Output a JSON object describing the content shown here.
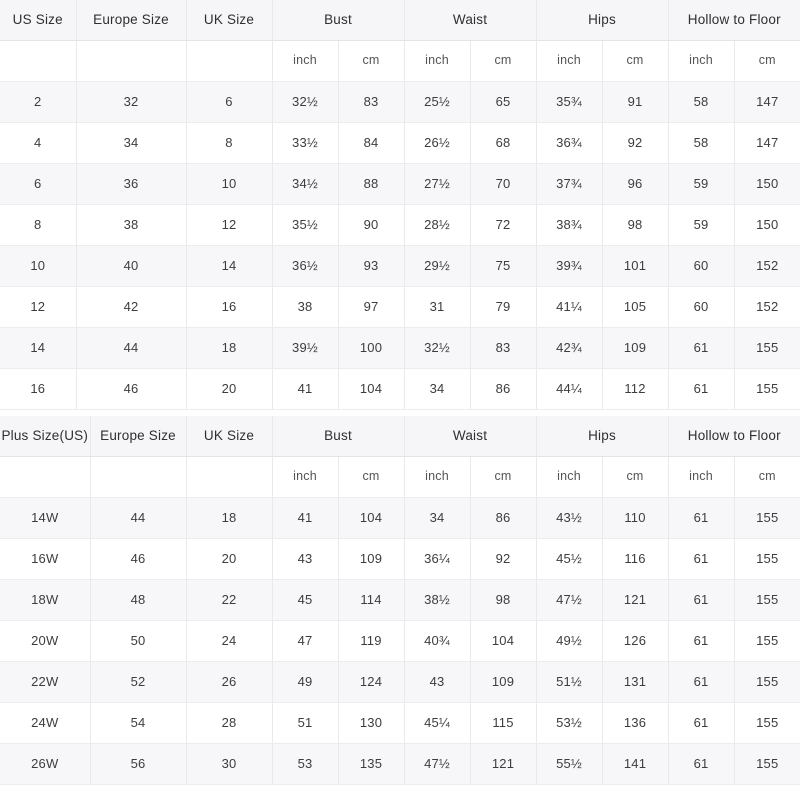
{
  "colors": {
    "header_bg": "#f6f6f8",
    "row_alt_bg": "#f7f7f9",
    "row_bg": "#ffffff",
    "border": "#e9e9ec",
    "text": "#3d3d3f"
  },
  "tables": [
    {
      "id": "standard-size-table",
      "headers": [
        "US Size",
        "Europe Size",
        "UK Size",
        "Bust",
        "Waist",
        "Hips",
        "Hollow to Floor"
      ],
      "units": [
        "",
        "",
        "",
        "inch",
        "cm",
        "inch",
        "cm",
        "inch",
        "cm",
        "inch",
        "cm"
      ],
      "rows": [
        [
          "2",
          "32",
          "6",
          "32½",
          "83",
          "25½",
          "65",
          "35¾",
          "91",
          "58",
          "147"
        ],
        [
          "4",
          "34",
          "8",
          "33½",
          "84",
          "26½",
          "68",
          "36¾",
          "92",
          "58",
          "147"
        ],
        [
          "6",
          "36",
          "10",
          "34½",
          "88",
          "27½",
          "70",
          "37¾",
          "96",
          "59",
          "150"
        ],
        [
          "8",
          "38",
          "12",
          "35½",
          "90",
          "28½",
          "72",
          "38¾",
          "98",
          "59",
          "150"
        ],
        [
          "10",
          "40",
          "14",
          "36½",
          "93",
          "29½",
          "75",
          "39¾",
          "101",
          "60",
          "152"
        ],
        [
          "12",
          "42",
          "16",
          "38",
          "97",
          "31",
          "79",
          "41¼",
          "105",
          "60",
          "152"
        ],
        [
          "14",
          "44",
          "18",
          "39½",
          "100",
          "32½",
          "83",
          "42¾",
          "109",
          "61",
          "155"
        ],
        [
          "16",
          "46",
          "20",
          "41",
          "104",
          "34",
          "86",
          "44¼",
          "112",
          "61",
          "155"
        ]
      ]
    },
    {
      "id": "plus-size-table",
      "headers": [
        "Plus Size(US)",
        "Europe Size",
        "UK Size",
        "Bust",
        "Waist",
        "Hips",
        "Hollow to Floor"
      ],
      "units": [
        "",
        "",
        "",
        "inch",
        "cm",
        "inch",
        "cm",
        "inch",
        "cm",
        "inch",
        "cm"
      ],
      "rows": [
        [
          "14W",
          "44",
          "18",
          "41",
          "104",
          "34",
          "86",
          "43½",
          "110",
          "61",
          "155"
        ],
        [
          "16W",
          "46",
          "20",
          "43",
          "109",
          "36¼",
          "92",
          "45½",
          "116",
          "61",
          "155"
        ],
        [
          "18W",
          "48",
          "22",
          "45",
          "114",
          "38½",
          "98",
          "47½",
          "121",
          "61",
          "155"
        ],
        [
          "20W",
          "50",
          "24",
          "47",
          "119",
          "40¾",
          "104",
          "49½",
          "126",
          "61",
          "155"
        ],
        [
          "22W",
          "52",
          "26",
          "49",
          "124",
          "43",
          "109",
          "51½",
          "131",
          "61",
          "155"
        ],
        [
          "24W",
          "54",
          "28",
          "51",
          "130",
          "45¼",
          "115",
          "53½",
          "136",
          "61",
          "155"
        ],
        [
          "26W",
          "56",
          "30",
          "53",
          "135",
          "47½",
          "121",
          "55½",
          "141",
          "61",
          "155"
        ]
      ]
    }
  ]
}
